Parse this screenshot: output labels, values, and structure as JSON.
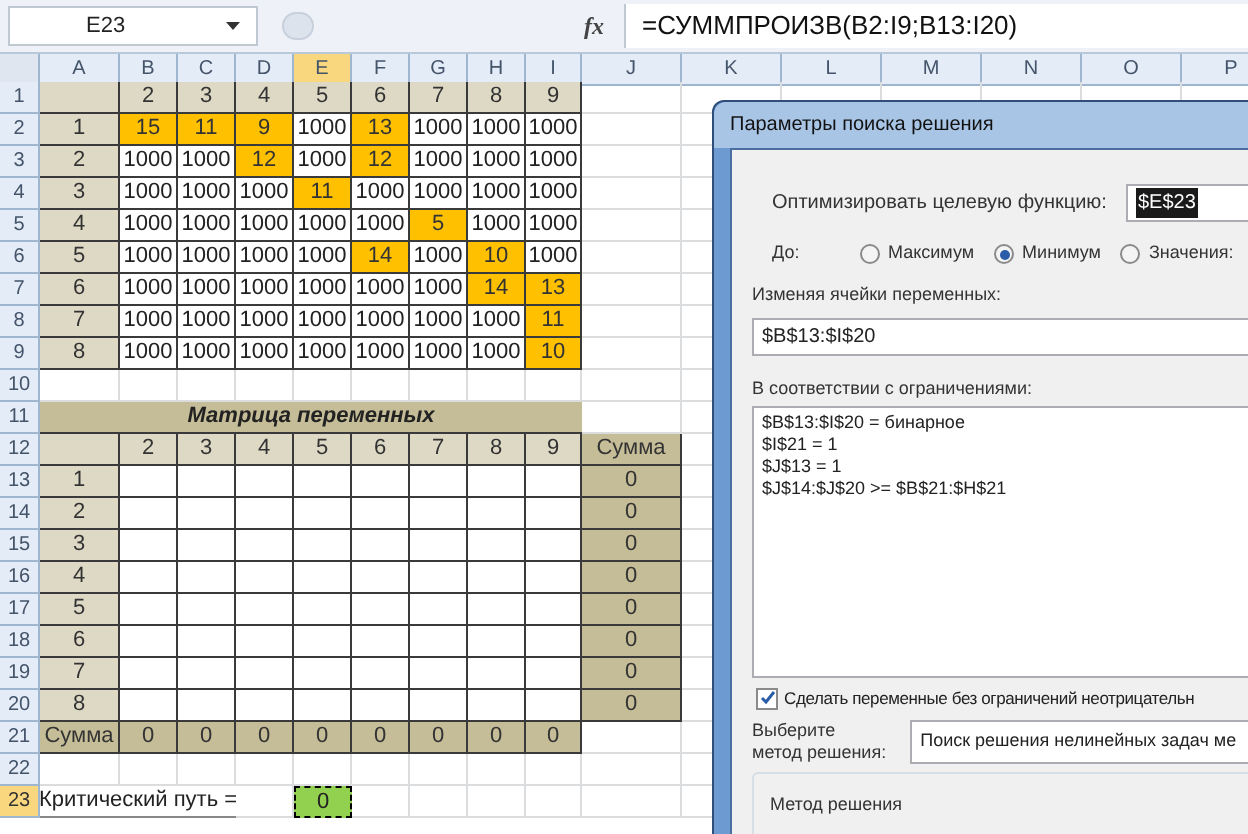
{
  "formula_bar": {
    "name_box": "E23",
    "function_label": "fx",
    "formula": "=СУММПРОИЗВ(B2:I9;B13:I20)"
  },
  "columns": [
    {
      "label": "A",
      "selected": false
    },
    {
      "label": "B",
      "selected": false
    },
    {
      "label": "C",
      "selected": false
    },
    {
      "label": "D",
      "selected": false
    },
    {
      "label": "E",
      "selected": true
    },
    {
      "label": "F",
      "selected": false
    },
    {
      "label": "G",
      "selected": false
    },
    {
      "label": "H",
      "selected": false
    },
    {
      "label": "I",
      "selected": false
    },
    {
      "label": "J",
      "selected": false
    },
    {
      "label": "K",
      "selected": false
    },
    {
      "label": "L",
      "selected": false
    },
    {
      "label": "M",
      "selected": false
    },
    {
      "label": "N",
      "selected": false
    },
    {
      "label": "O",
      "selected": false
    },
    {
      "label": "P",
      "selected": false
    }
  ],
  "rows": [
    {
      "number": "1",
      "selected": false,
      "cells": [
        {
          "kind": "label"
        },
        {
          "kind": "label",
          "text": "2"
        },
        {
          "kind": "label",
          "text": "3"
        },
        {
          "kind": "label",
          "text": "4"
        },
        {
          "kind": "label",
          "text": "5"
        },
        {
          "kind": "label",
          "text": "6"
        },
        {
          "kind": "label",
          "text": "7"
        },
        {
          "kind": "label",
          "text": "8"
        },
        {
          "kind": "label",
          "text": "9"
        }
      ]
    },
    {
      "number": "2",
      "selected": false,
      "cells": [
        {
          "kind": "label",
          "text": "1"
        },
        {
          "kind": "high",
          "text": "15"
        },
        {
          "kind": "high",
          "text": "11"
        },
        {
          "kind": "high",
          "text": "9"
        },
        {
          "kind": "value",
          "text": "1000"
        },
        {
          "kind": "high",
          "text": "13"
        },
        {
          "kind": "value",
          "text": "1000"
        },
        {
          "kind": "value",
          "text": "1000"
        },
        {
          "kind": "value",
          "text": "1000"
        }
      ]
    },
    {
      "number": "3",
      "selected": false,
      "cells": [
        {
          "kind": "label",
          "text": "2"
        },
        {
          "kind": "value",
          "text": "1000"
        },
        {
          "kind": "value",
          "text": "1000"
        },
        {
          "kind": "high",
          "text": "12"
        },
        {
          "kind": "value",
          "text": "1000"
        },
        {
          "kind": "high",
          "text": "12"
        },
        {
          "kind": "value",
          "text": "1000"
        },
        {
          "kind": "value",
          "text": "1000"
        },
        {
          "kind": "value",
          "text": "1000"
        }
      ]
    },
    {
      "number": "4",
      "selected": false,
      "cells": [
        {
          "kind": "label",
          "text": "3"
        },
        {
          "kind": "value",
          "text": "1000"
        },
        {
          "kind": "value",
          "text": "1000"
        },
        {
          "kind": "value",
          "text": "1000"
        },
        {
          "kind": "high",
          "text": "11"
        },
        {
          "kind": "value",
          "text": "1000"
        },
        {
          "kind": "value",
          "text": "1000"
        },
        {
          "kind": "value",
          "text": "1000"
        },
        {
          "kind": "value",
          "text": "1000"
        }
      ]
    },
    {
      "number": "5",
      "selected": false,
      "cells": [
        {
          "kind": "label",
          "text": "4"
        },
        {
          "kind": "value",
          "text": "1000"
        },
        {
          "kind": "value",
          "text": "1000"
        },
        {
          "kind": "value",
          "text": "1000"
        },
        {
          "kind": "value",
          "text": "1000"
        },
        {
          "kind": "value",
          "text": "1000"
        },
        {
          "kind": "high",
          "text": "5"
        },
        {
          "kind": "value",
          "text": "1000"
        },
        {
          "kind": "value",
          "text": "1000"
        }
      ]
    },
    {
      "number": "6",
      "selected": false,
      "cells": [
        {
          "kind": "label",
          "text": "5"
        },
        {
          "kind": "value",
          "text": "1000"
        },
        {
          "kind": "value",
          "text": "1000"
        },
        {
          "kind": "value",
          "text": "1000"
        },
        {
          "kind": "value",
          "text": "1000"
        },
        {
          "kind": "high",
          "text": "14"
        },
        {
          "kind": "value",
          "text": "1000"
        },
        {
          "kind": "high",
          "text": "10"
        },
        {
          "kind": "value",
          "text": "1000"
        }
      ]
    },
    {
      "number": "7",
      "selected": false,
      "cells": [
        {
          "kind": "label",
          "text": "6"
        },
        {
          "kind": "value",
          "text": "1000"
        },
        {
          "kind": "value",
          "text": "1000"
        },
        {
          "kind": "value",
          "text": "1000"
        },
        {
          "kind": "value",
          "text": "1000"
        },
        {
          "kind": "value",
          "text": "1000"
        },
        {
          "kind": "value",
          "text": "1000"
        },
        {
          "kind": "high",
          "text": "14"
        },
        {
          "kind": "high",
          "text": "13"
        }
      ]
    },
    {
      "number": "8",
      "selected": false,
      "cells": [
        {
          "kind": "label",
          "text": "7"
        },
        {
          "kind": "value",
          "text": "1000"
        },
        {
          "kind": "value",
          "text": "1000"
        },
        {
          "kind": "value",
          "text": "1000"
        },
        {
          "kind": "value",
          "text": "1000"
        },
        {
          "kind": "value",
          "text": "1000"
        },
        {
          "kind": "value",
          "text": "1000"
        },
        {
          "kind": "value",
          "text": "1000"
        },
        {
          "kind": "high",
          "text": "11"
        }
      ]
    },
    {
      "number": "9",
      "selected": false,
      "cells": [
        {
          "kind": "label",
          "text": "8"
        },
        {
          "kind": "value",
          "text": "1000"
        },
        {
          "kind": "value",
          "text": "1000"
        },
        {
          "kind": "value",
          "text": "1000"
        },
        {
          "kind": "value",
          "text": "1000"
        },
        {
          "kind": "value",
          "text": "1000"
        },
        {
          "kind": "value",
          "text": "1000"
        },
        {
          "kind": "value",
          "text": "1000"
        },
        {
          "kind": "high",
          "text": "10"
        }
      ]
    },
    {
      "number": "10",
      "selected": false
    },
    {
      "number": "11",
      "selected": false,
      "cells": [
        {
          "kind": "title",
          "text": "Матрица переменных"
        }
      ]
    },
    {
      "number": "12",
      "selected": false,
      "cells": [
        {
          "kind": "label"
        },
        {
          "kind": "label",
          "text": "2"
        },
        {
          "kind": "label",
          "text": "3"
        },
        {
          "kind": "label",
          "text": "4"
        },
        {
          "kind": "label",
          "text": "5"
        },
        {
          "kind": "label",
          "text": "6"
        },
        {
          "kind": "label",
          "text": "7"
        },
        {
          "kind": "label",
          "text": "8"
        },
        {
          "kind": "label",
          "text": "9"
        },
        {
          "kind": "sum",
          "text": "Сумма"
        }
      ]
    },
    {
      "number": "13",
      "selected": false,
      "cells": [
        {
          "kind": "label",
          "text": "1"
        },
        {
          "kind": "value"
        },
        {
          "kind": "value"
        },
        {
          "kind": "value"
        },
        {
          "kind": "value"
        },
        {
          "kind": "value"
        },
        {
          "kind": "value"
        },
        {
          "kind": "value"
        },
        {
          "kind": "value"
        },
        {
          "kind": "sum",
          "text": "0"
        }
      ]
    },
    {
      "number": "14",
      "selected": false,
      "cells": [
        {
          "kind": "label",
          "text": "2"
        },
        {
          "kind": "value"
        },
        {
          "kind": "value"
        },
        {
          "kind": "value"
        },
        {
          "kind": "value"
        },
        {
          "kind": "value"
        },
        {
          "kind": "value"
        },
        {
          "kind": "value"
        },
        {
          "kind": "value"
        },
        {
          "kind": "sum",
          "text": "0"
        }
      ]
    },
    {
      "number": "15",
      "selected": false,
      "cells": [
        {
          "kind": "label",
          "text": "3"
        },
        {
          "kind": "value"
        },
        {
          "kind": "value"
        },
        {
          "kind": "value"
        },
        {
          "kind": "value"
        },
        {
          "kind": "value"
        },
        {
          "kind": "value"
        },
        {
          "kind": "value"
        },
        {
          "kind": "value"
        },
        {
          "kind": "sum",
          "text": "0"
        }
      ]
    },
    {
      "number": "16",
      "selected": false,
      "cells": [
        {
          "kind": "label",
          "text": "4"
        },
        {
          "kind": "value"
        },
        {
          "kind": "value"
        },
        {
          "kind": "value"
        },
        {
          "kind": "value"
        },
        {
          "kind": "value"
        },
        {
          "kind": "value"
        },
        {
          "kind": "value"
        },
        {
          "kind": "value"
        },
        {
          "kind": "sum",
          "text": "0"
        }
      ]
    },
    {
      "number": "17",
      "selected": false,
      "cells": [
        {
          "kind": "label",
          "text": "5"
        },
        {
          "kind": "value"
        },
        {
          "kind": "value"
        },
        {
          "kind": "value"
        },
        {
          "kind": "value"
        },
        {
          "kind": "value"
        },
        {
          "kind": "value"
        },
        {
          "kind": "value"
        },
        {
          "kind": "value"
        },
        {
          "kind": "sum",
          "text": "0"
        }
      ]
    },
    {
      "number": "18",
      "selected": false,
      "cells": [
        {
          "kind": "label",
          "text": "6"
        },
        {
          "kind": "value"
        },
        {
          "kind": "value"
        },
        {
          "kind": "value"
        },
        {
          "kind": "value"
        },
        {
          "kind": "value"
        },
        {
          "kind": "value"
        },
        {
          "kind": "value"
        },
        {
          "kind": "value"
        },
        {
          "kind": "sum",
          "text": "0"
        }
      ]
    },
    {
      "number": "19",
      "selected": false,
      "cells": [
        {
          "kind": "label",
          "text": "7"
        },
        {
          "kind": "value"
        },
        {
          "kind": "value"
        },
        {
          "kind": "value"
        },
        {
          "kind": "value"
        },
        {
          "kind": "value"
        },
        {
          "kind": "value"
        },
        {
          "kind": "value"
        },
        {
          "kind": "value"
        },
        {
          "kind": "sum",
          "text": "0"
        }
      ]
    },
    {
      "number": "20",
      "selected": false,
      "cells": [
        {
          "kind": "label",
          "text": "8"
        },
        {
          "kind": "value"
        },
        {
          "kind": "value"
        },
        {
          "kind": "value"
        },
        {
          "kind": "value"
        },
        {
          "kind": "value"
        },
        {
          "kind": "value"
        },
        {
          "kind": "value"
        },
        {
          "kind": "value"
        },
        {
          "kind": "sum",
          "text": "0"
        }
      ]
    },
    {
      "number": "21",
      "selected": false,
      "cells": [
        {
          "kind": "sum",
          "text": "Сумма"
        },
        {
          "kind": "sum",
          "text": "0"
        },
        {
          "kind": "sum",
          "text": "0"
        },
        {
          "kind": "sum",
          "text": "0"
        },
        {
          "kind": "sum",
          "text": "0"
        },
        {
          "kind": "sum",
          "text": "0"
        },
        {
          "kind": "sum",
          "text": "0"
        },
        {
          "kind": "sum",
          "text": "0"
        },
        {
          "kind": "sum",
          "text": "0"
        }
      ]
    },
    {
      "number": "22",
      "selected": false
    },
    {
      "number": "23",
      "selected": true,
      "cells": [
        {
          "kind": "text",
          "text": "Критический путь ="
        },
        {
          "kind": "blank"
        },
        {
          "kind": "result",
          "text": "0"
        }
      ]
    }
  ],
  "dialog": {
    "title": "Параметры поиска решения",
    "objective": {
      "label": "Оптимизировать целевую функцию:",
      "value": "$E$23"
    },
    "to": {
      "label": "До:",
      "options": [
        {
          "label": "Максимум",
          "selected": false
        },
        {
          "label": "Минимум",
          "selected": true
        },
        {
          "label": "Значения:",
          "selected": false
        }
      ]
    },
    "variables": {
      "label": "Изменяя ячейки переменных:",
      "value": "$B$13:$I$20"
    },
    "constraints": {
      "label": "В соответствии с ограничениями:",
      "items": [
        "$B$13:$I$20 = бинарное",
        "$I$21 = 1",
        "$J$13 = 1",
        "$J$14:$J$20 >= $B$21:$H$21"
      ]
    },
    "nonnegative": {
      "label": "Сделать переменные без ограничений неотрицательн",
      "checked": true
    },
    "method": {
      "label_lines": [
        "Выберите",
        "метод решения:"
      ],
      "value": "Поиск решения нелинейных задач ме"
    },
    "method_group": {
      "title": "Метод решения"
    }
  }
}
